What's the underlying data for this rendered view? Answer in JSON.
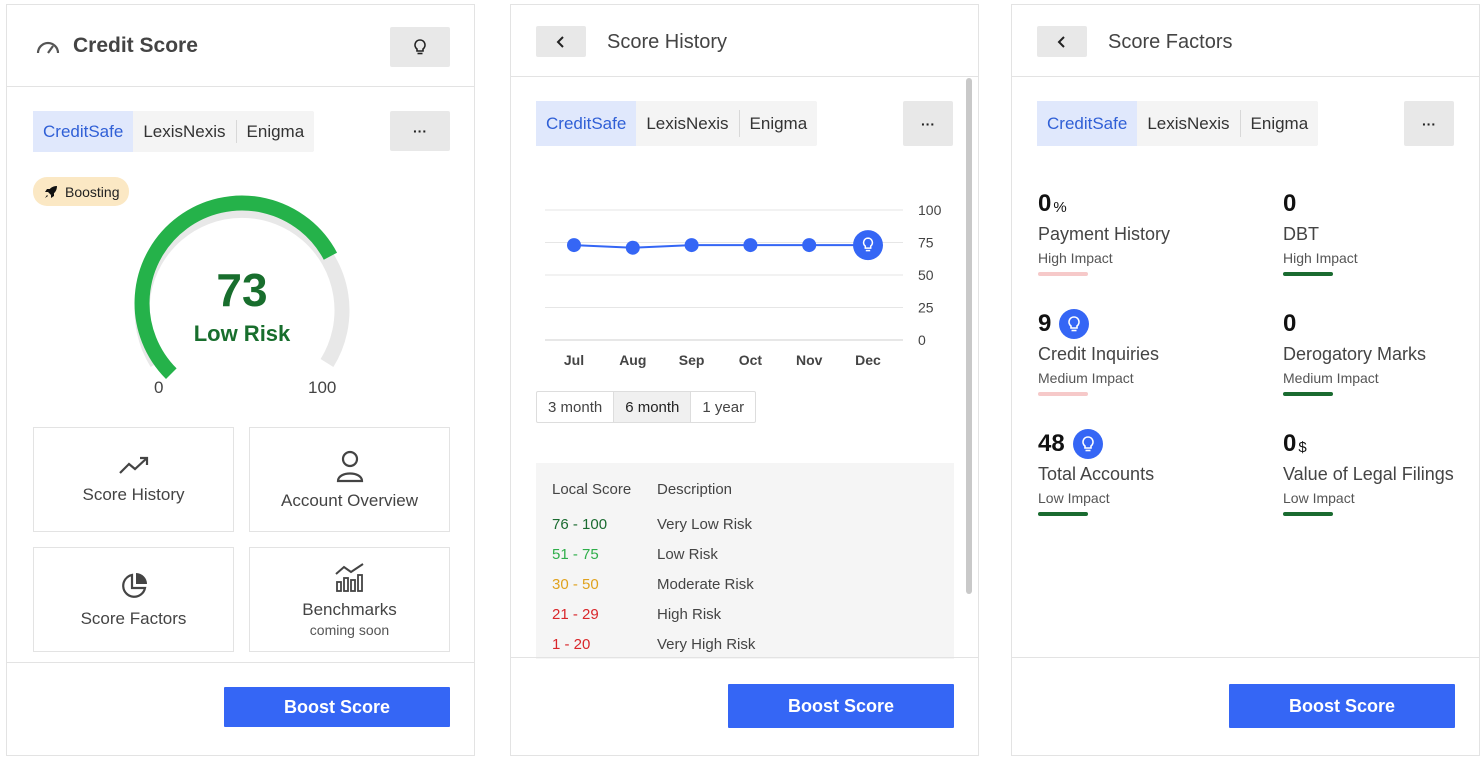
{
  "colors": {
    "accent": "#3566f5",
    "gauge_green": "#25b24a",
    "score_text": "#186e2d",
    "impact_low": "#1a6b30",
    "impact_high": "#f6c9c9"
  },
  "credit_score": {
    "title": "Credit Score",
    "title_icon": "speedometer-icon",
    "tip_icon": "lightbulb-icon",
    "bureaus": [
      "CreditSafe",
      "LexisNexis",
      "Enigma"
    ],
    "active_bureau": "CreditSafe",
    "more_label": "···",
    "badge": "Boosting",
    "badge_icon": "rocket-icon",
    "score": "73",
    "score_fraction": 0.73,
    "risk_label": "Low Risk",
    "min_label": "0",
    "max_label": "100",
    "tiles": [
      {
        "label": "Score History",
        "icon": "trending-up-icon"
      },
      {
        "label": "Account Overview",
        "icon": "user-icon"
      },
      {
        "label": "Score Factors",
        "icon": "pie-chart-icon"
      },
      {
        "label": "Benchmarks",
        "sublabel": "coming soon",
        "icon": "bar-line-chart-icon"
      }
    ],
    "boost_label": "Boost Score"
  },
  "score_history": {
    "back_icon": "chevron-left-icon",
    "title": "Score History",
    "bureaus": [
      "CreditSafe",
      "LexisNexis",
      "Enigma"
    ],
    "more_label": "···",
    "ranges": [
      "3 month",
      "6 month",
      "1 year"
    ],
    "active_range": "6 month",
    "legend": {
      "headers": [
        "Local Score",
        "Description"
      ],
      "rows": [
        {
          "range": "76 - 100",
          "desc": "Very Low Risk",
          "color": "#1a6b30"
        },
        {
          "range": "51 - 75",
          "desc": "Low Risk",
          "color": "#2fae4a"
        },
        {
          "range": "30 - 50",
          "desc": "Moderate Risk",
          "color": "#e0a21e"
        },
        {
          "range": "21 - 29",
          "desc": "High Risk",
          "color": "#d9262a"
        },
        {
          "range": "1 - 20",
          "desc": "Very High Risk",
          "color": "#d9262a"
        }
      ]
    },
    "boost_label": "Boost Score"
  },
  "chart_data": {
    "type": "line",
    "categories": [
      "Jul",
      "Aug",
      "Sep",
      "Oct",
      "Nov",
      "Dec"
    ],
    "series": [
      {
        "values": [
          73,
          71,
          73,
          73,
          73,
          73
        ]
      }
    ],
    "ylim": [
      0,
      100
    ],
    "yticks": [
      "100",
      "75",
      "50",
      "25",
      "0"
    ],
    "grid": true,
    "last_point_icon": "lightbulb-icon"
  },
  "score_factors": {
    "back_icon": "chevron-left-icon",
    "title": "Score Factors",
    "bureaus": [
      "CreditSafe",
      "LexisNexis",
      "Enigma"
    ],
    "more_label": "···",
    "factors": [
      {
        "value": "0",
        "unit": "%",
        "name": "Payment History",
        "impact": "High Impact",
        "bar_color": "#f6c9c9",
        "tip": false
      },
      {
        "value": "0",
        "unit": "",
        "name": "DBT",
        "impact": "High Impact",
        "bar_color": "#1a6b30",
        "tip": false
      },
      {
        "value": "9",
        "unit": "",
        "name": "Credit Inquiries",
        "impact": "Medium Impact",
        "bar_color": "#f6c9c9",
        "tip": true
      },
      {
        "value": "0",
        "unit": "",
        "name": "Derogatory Marks",
        "impact": "Medium Impact",
        "bar_color": "#1a6b30",
        "tip": false
      },
      {
        "value": "48",
        "unit": "",
        "name": "Total Accounts",
        "impact": "Low Impact",
        "bar_color": "#1a6b30",
        "tip": true
      },
      {
        "value": "0",
        "unit": "$",
        "name": "Value of Legal Filings",
        "impact": "Low Impact",
        "bar_color": "#1a6b30",
        "tip": false
      }
    ],
    "boost_label": "Boost Score"
  }
}
